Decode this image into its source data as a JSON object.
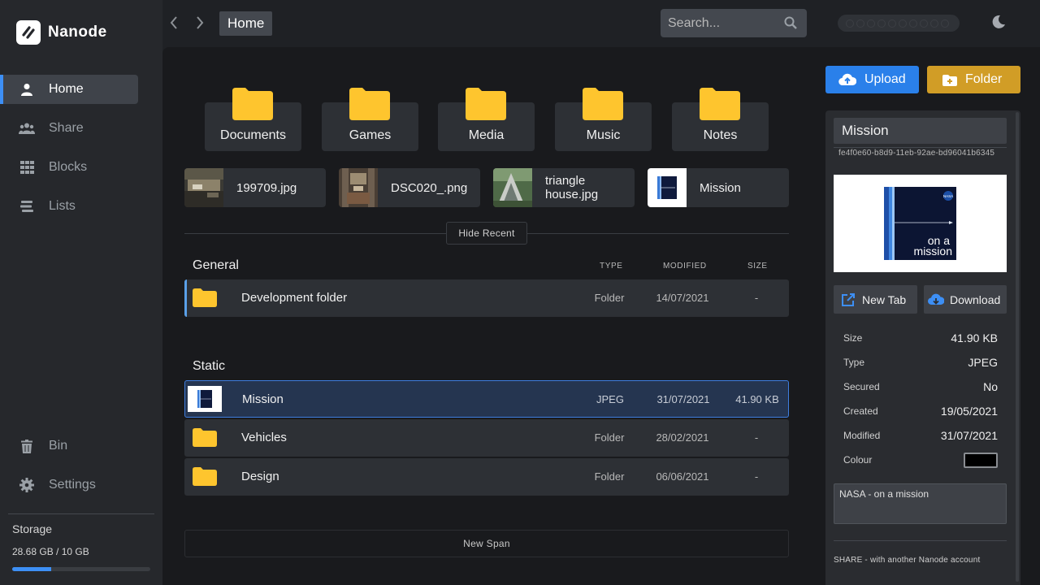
{
  "app": {
    "name": "Nanode"
  },
  "sidebar": {
    "items": [
      {
        "label": "Home",
        "icon": "user-icon",
        "active": true
      },
      {
        "label": "Share",
        "icon": "users-icon"
      },
      {
        "label": "Blocks",
        "icon": "grid-icon"
      },
      {
        "label": "Lists",
        "icon": "list-icon"
      }
    ],
    "bottom_items": [
      {
        "label": "Bin",
        "icon": "trash-icon"
      },
      {
        "label": "Settings",
        "icon": "gear-icon"
      }
    ],
    "storage": {
      "title": "Storage",
      "value": "28.68 GB / 10 GB",
      "fill_fraction": 0.28
    }
  },
  "topbar": {
    "breadcrumb": "Home",
    "search_placeholder": "Search..."
  },
  "main": {
    "folders": [
      "Documents",
      "Games",
      "Media",
      "Music",
      "Notes"
    ],
    "recent": [
      {
        "name": "199709.jpg"
      },
      {
        "name": "DSC020_.png"
      },
      {
        "name": "triangle house.jpg"
      },
      {
        "name": "Mission"
      }
    ],
    "hide_recent_label": "Hide Recent",
    "columns": {
      "type": "TYPE",
      "modified": "MODIFIED",
      "size": "SIZE"
    },
    "spans": [
      {
        "title": "General",
        "rows": [
          {
            "name": "Development folder",
            "type": "Folder",
            "modified": "14/07/2021",
            "size": "-"
          }
        ]
      },
      {
        "title": "Static",
        "rows": [
          {
            "name": "Mission",
            "type": "JPEG",
            "modified": "31/07/2021",
            "size": "41.90 KB"
          },
          {
            "name": "Vehicles",
            "type": "Folder",
            "modified": "28/02/2021",
            "size": "-"
          },
          {
            "name": "Design",
            "type": "Folder",
            "modified": "06/06/2021",
            "size": "-"
          }
        ]
      }
    ],
    "new_span_label": "New Span"
  },
  "actions": {
    "upload_label": "Upload",
    "folder_label": "Folder"
  },
  "details": {
    "name": "Mission",
    "id": "fe4f0e60-b8d9-11eb-92ae-bd96041b6345",
    "preview_text": "on a\nmission",
    "preview_badge": "NASA",
    "new_tab_label": "New Tab",
    "download_label": "Download",
    "meta": [
      {
        "key": "Size",
        "value": "41.90 KB"
      },
      {
        "key": "Type",
        "value": "JPEG"
      },
      {
        "key": "Secured",
        "value": "No"
      },
      {
        "key": "Created",
        "value": "19/05/2021"
      },
      {
        "key": "Modified",
        "value": "31/07/2021"
      }
    ],
    "colour_label": "Colour",
    "colour_value": "#000000",
    "notes": "NASA - on a mission",
    "share_text": "SHARE - with another Nanode account"
  },
  "colors": {
    "accent": "#2a80ea",
    "folder": "#fec52e",
    "folder_button": "#d19d26"
  }
}
